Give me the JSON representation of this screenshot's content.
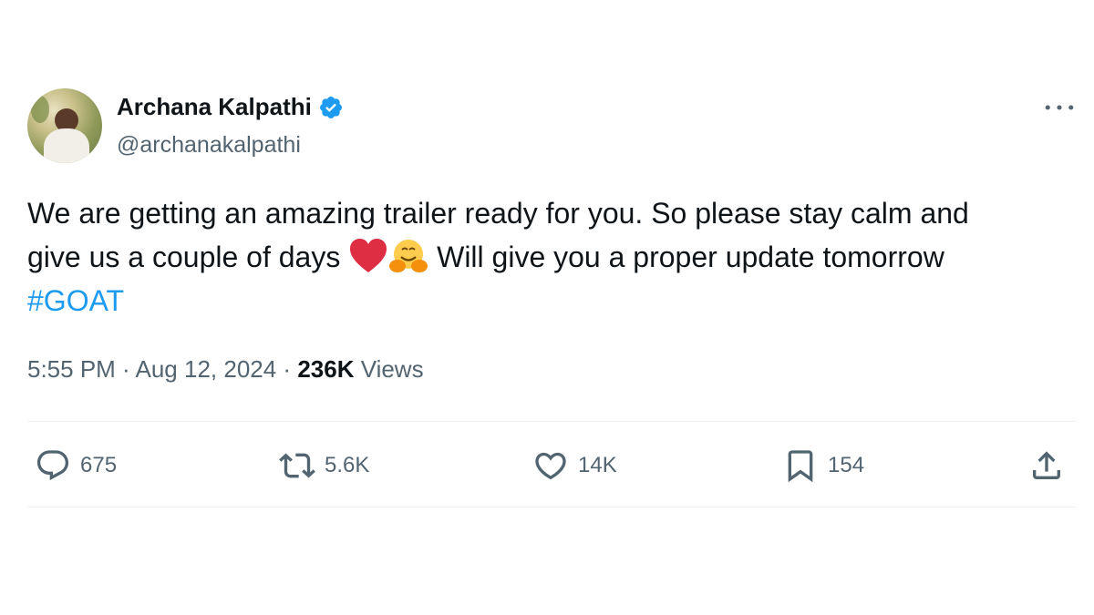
{
  "author": {
    "display_name": "Archana Kalpathi",
    "handle": "@archanakalpathi",
    "verified": true,
    "verified_color": "#1d9bf0"
  },
  "tweet": {
    "line1": "We are getting an amazing trailer ready for you. So please stay calm and",
    "line2_before": "give us a couple of days ",
    "line2_after": " Will give you a proper update tomorrow",
    "emojis": [
      "red-heart-emoji",
      "hugging-face-emoji"
    ],
    "hashtag": "#GOAT",
    "hashtag_color": "#1d9bf0"
  },
  "meta": {
    "time": "5:55 PM",
    "sep1": " · ",
    "date": "Aug 12, 2024",
    "sep2": " · ",
    "views_count": "236K",
    "views_label": " Views"
  },
  "actions": {
    "replies": "675",
    "reposts": "5.6K",
    "likes": "14K",
    "bookmarks": "154"
  }
}
